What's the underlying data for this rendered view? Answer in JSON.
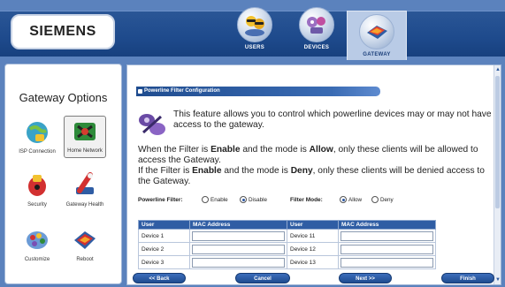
{
  "brand": {
    "name": "SIEMENS"
  },
  "nav": {
    "tabs": [
      {
        "label": "USERS",
        "icon": "users-icon"
      },
      {
        "label": "DEVICES",
        "icon": "devices-icon"
      },
      {
        "label": "GATEWAY",
        "icon": "gateway-icon",
        "active": true
      }
    ]
  },
  "sidebar": {
    "title": "Gateway Options",
    "items": [
      {
        "label": "ISP Connection",
        "icon": "isp-connection-icon"
      },
      {
        "label": "Home Network",
        "icon": "home-network-icon",
        "selected": true
      },
      {
        "label": "Security",
        "icon": "security-icon"
      },
      {
        "label": "Gateway Health",
        "icon": "gateway-health-icon"
      },
      {
        "label": "Customize",
        "icon": "customize-icon"
      },
      {
        "label": "Reboot",
        "icon": "reboot-icon"
      }
    ]
  },
  "main": {
    "section_title": "Powerline Filter Configuration",
    "intro": "This feature allows you to control which powerline devices may or may not have access to the gateway.",
    "para1": {
      "pre": "When the Filter is ",
      "enable": "Enable",
      "mid": " and the mode is ",
      "mode": "Allow",
      "post": ", only these clients will be allowed to access the Gateway."
    },
    "para2": {
      "pre": "If the Filter is ",
      "enable": "Enable",
      "mid": " and the mode is ",
      "mode": "Deny",
      "post": ", only these clients will be denied access to the Gateway."
    },
    "filter": {
      "label": "Powerline Filter:",
      "options": [
        "Enable",
        "Disable"
      ],
      "selected": "Disable"
    },
    "mode": {
      "label": "Filter Mode:",
      "options": [
        "Allow",
        "Deny"
      ],
      "selected": "Allow"
    },
    "table": {
      "headers": [
        "User",
        "MAC Address",
        "User",
        "MAC Address"
      ],
      "rows": [
        {
          "left": "Device 1",
          "right": "Device 11"
        },
        {
          "left": "Device 2",
          "right": "Device 12"
        },
        {
          "left": "Device 3",
          "right": "Device 13"
        }
      ]
    }
  },
  "buttons": {
    "back": "<< Back",
    "cancel": "Cancel",
    "next": "Next >>",
    "finish": "Finish"
  },
  "colors": {
    "background": "#5b82bd",
    "header_band": "#1e4a8c",
    "table_header": "#2f5da4",
    "button": "#2a5aa5"
  }
}
